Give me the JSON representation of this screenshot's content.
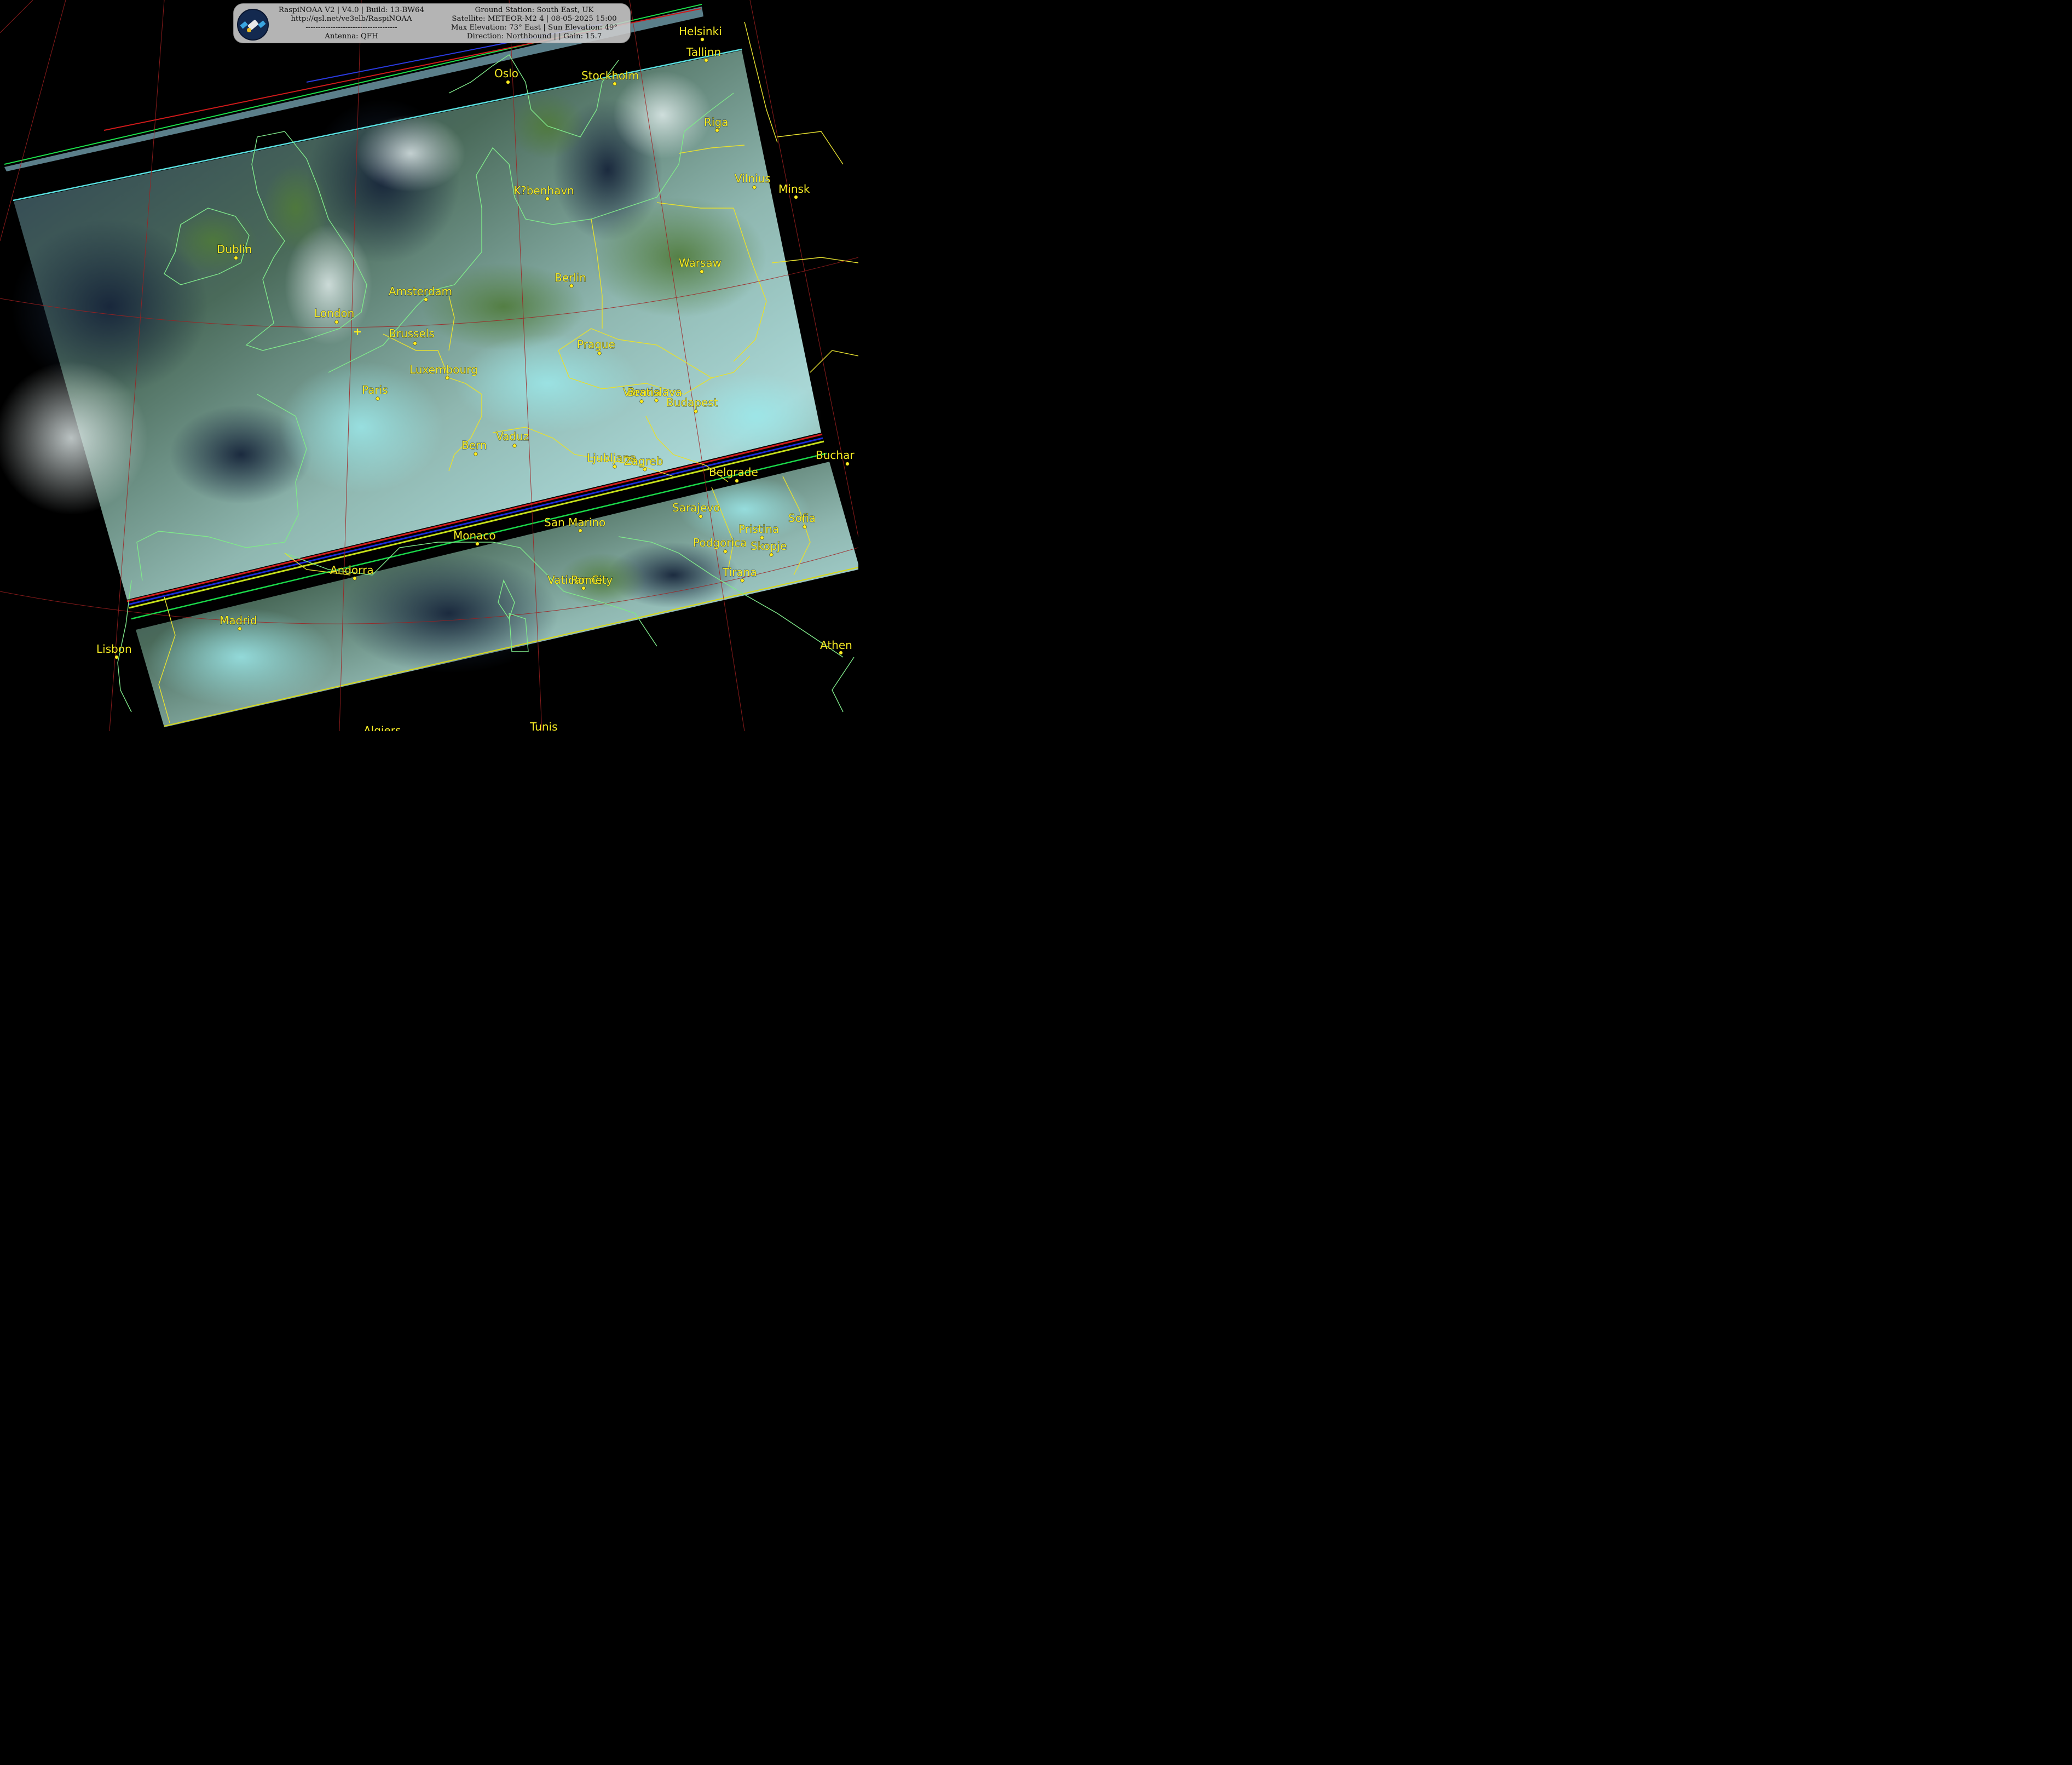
{
  "header": {
    "left_lines": [
      "RaspiNOAA V2 | V4.0 | Build: 13-BW64",
      "http://qsl.net/ve3elb/RaspiNOAA",
      "-------------------------------------",
      "Antenna: QFH"
    ],
    "right_lines": [
      "Ground Station: South East, UK",
      "Satellite: METEOR-M2 4 | 08-05-2025 15:00",
      "Max Elevation: 73° East | Sun Elevation: 49°",
      "Direction: Northbound | | Gain: 15.7"
    ]
  },
  "icons": {
    "logo": "satellite-logo-icon",
    "station": "ground-station-marker-icon"
  },
  "colors": {
    "background": "#000000",
    "city_label": "#f5ea24",
    "coastline": "#7fe88a",
    "border": "#e6e030",
    "graticule": "#a02020"
  },
  "cities": [
    {
      "name": "Helsinki"
    },
    {
      "name": "Tallinn"
    },
    {
      "name": "Oslo"
    },
    {
      "name": "Stockholm"
    },
    {
      "name": "Riga"
    },
    {
      "name": "Vilnius"
    },
    {
      "name": "Minsk"
    },
    {
      "name": "K?benhavn"
    },
    {
      "name": "Dublin"
    },
    {
      "name": "Berlin"
    },
    {
      "name": "Warsaw"
    },
    {
      "name": "Amsterdam"
    },
    {
      "name": "London"
    },
    {
      "name": "Brussels"
    },
    {
      "name": "Prague"
    },
    {
      "name": "Luxembourg"
    },
    {
      "name": "Paris"
    },
    {
      "name": "Vienna"
    },
    {
      "name": "Bratislava"
    },
    {
      "name": "Budapest"
    },
    {
      "name": "Bern"
    },
    {
      "name": "Vaduz"
    },
    {
      "name": "Ljubljana"
    },
    {
      "name": "Zagreb"
    },
    {
      "name": "Buchar"
    },
    {
      "name": "Belgrade"
    },
    {
      "name": "Sarajevo"
    },
    {
      "name": "Sofia"
    },
    {
      "name": "Pristina"
    },
    {
      "name": "San Marino"
    },
    {
      "name": "Monaco"
    },
    {
      "name": "Podgorica"
    },
    {
      "name": "Skopje"
    },
    {
      "name": "Andorra"
    },
    {
      "name": "Tirana"
    },
    {
      "name": "Vatican City"
    },
    {
      "name": "Rome"
    },
    {
      "name": "Madrid"
    },
    {
      "name": "Lisbon"
    },
    {
      "name": "Athen"
    },
    {
      "name": "Algiers"
    },
    {
      "name": "Tunis"
    }
  ]
}
